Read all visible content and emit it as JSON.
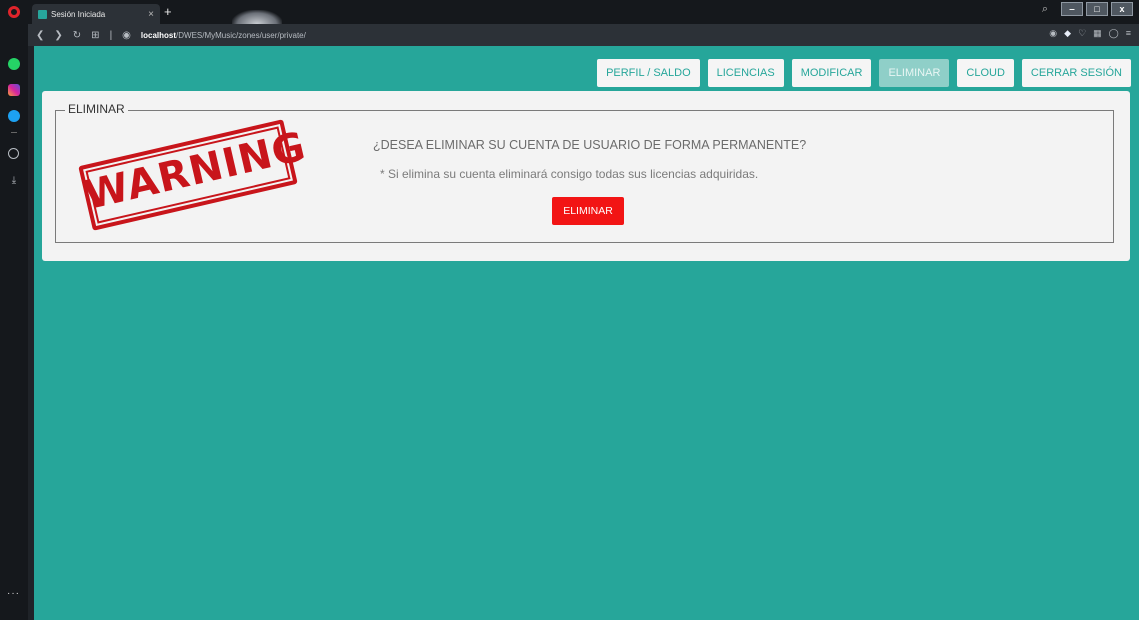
{
  "browser": {
    "tab_title": "Sesión Iniciada",
    "tab_close": "×",
    "new_tab": "+",
    "url_host": "localhost",
    "url_path": "/DWES/MyMusic/zones/user/private/",
    "icons": [
      "opera-logo",
      "back-icon",
      "forward-icon",
      "reload-icon",
      "tabs-grid-icon",
      "globe-icon",
      "camera-icon",
      "vpn-icon",
      "heart-icon",
      "extensions-icon",
      "package-icon",
      "menu-icon"
    ]
  },
  "window": {
    "search": "⌕",
    "minimize": "‒",
    "maximize": "□",
    "close": "x"
  },
  "sidebar": {
    "more": "···"
  },
  "nav": {
    "items": [
      {
        "label": "PERFIL / SALDO",
        "active": false
      },
      {
        "label": "LICENCIAS",
        "active": false
      },
      {
        "label": "MODIFICAR",
        "active": false
      },
      {
        "label": "ELIMINAR",
        "active": true
      },
      {
        "label": "CLOUD",
        "active": false
      },
      {
        "label": "CERRAR SESIÓN",
        "active": false
      }
    ]
  },
  "panel": {
    "legend": "ELIMINAR",
    "stamp_text": "WARNING",
    "question": "¿DESEA ELIMINAR SU CUENTA DE USUARIO DE FORMA PERMANENTE?",
    "note": "* Si elimina su cuenta eliminará consigo todas sus licencias adquiridas.",
    "button": "ELIMINAR"
  },
  "colors": {
    "page_bg": "#26a69a",
    "danger": "#f21414",
    "stamp": "#c8151b"
  }
}
